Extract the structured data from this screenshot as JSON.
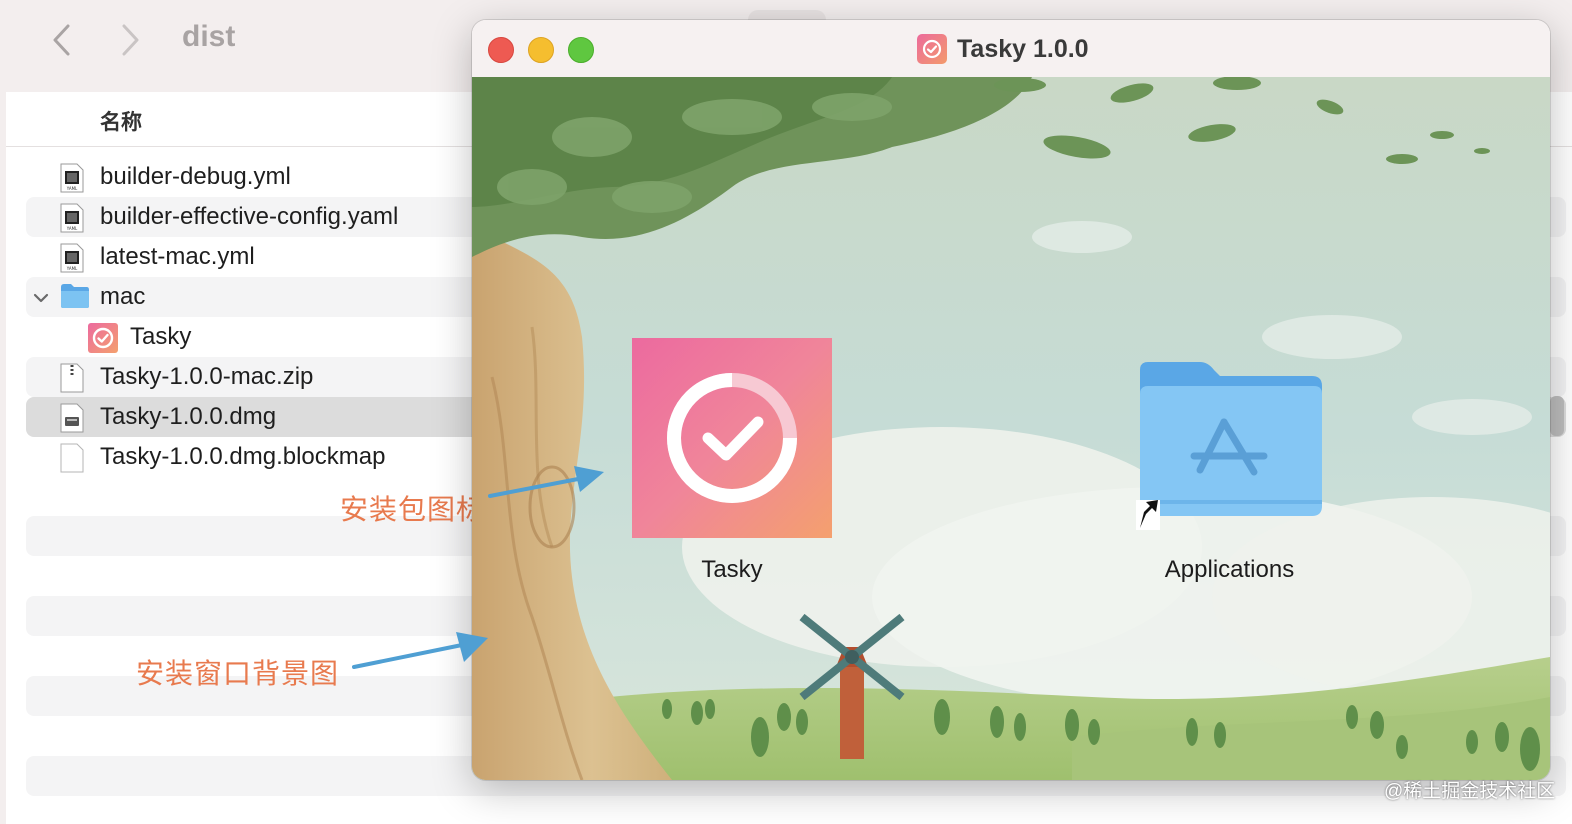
{
  "finder": {
    "title": "dist",
    "column_header": "名称",
    "files": [
      {
        "name": "builder-debug.yml",
        "kind": "yaml-file",
        "indent": 0,
        "alt": false,
        "selected": false,
        "disclosure": false
      },
      {
        "name": "builder-effective-config.yaml",
        "kind": "yaml-file",
        "indent": 0,
        "alt": true,
        "selected": false,
        "disclosure": false
      },
      {
        "name": "latest-mac.yml",
        "kind": "yaml-file",
        "indent": 0,
        "alt": false,
        "selected": false,
        "disclosure": false
      },
      {
        "name": "mac",
        "kind": "folder",
        "indent": 0,
        "alt": true,
        "selected": false,
        "disclosure": true
      },
      {
        "name": "Tasky",
        "kind": "app",
        "indent": 1,
        "alt": false,
        "selected": false,
        "disclosure": false
      },
      {
        "name": "Tasky-1.0.0-mac.zip",
        "kind": "zip-file",
        "indent": 0,
        "alt": true,
        "selected": false,
        "disclosure": false
      },
      {
        "name": "Tasky-1.0.0.dmg",
        "kind": "dmg-file",
        "indent": 0,
        "alt": false,
        "selected": true,
        "disclosure": false
      },
      {
        "name": "Tasky-1.0.0.dmg.blockmap",
        "kind": "blank-file",
        "indent": 0,
        "alt": false,
        "selected": false,
        "disclosure": false
      }
    ]
  },
  "annotations": {
    "icon_label": "安装包图标",
    "background_label": "安装窗口背景图",
    "color": "#e87a4e",
    "arrow_color": "#4f9fd3"
  },
  "dmg_window": {
    "title": "Tasky 1.0.0",
    "app_label": "Tasky",
    "applications_label": "Applications"
  },
  "watermark": "@稀土掘金技术社区",
  "colors": {
    "app_gradient_start": "#ec6a9f",
    "app_gradient_end": "#f4a06e",
    "folder_blue": "#7cc3f2"
  }
}
